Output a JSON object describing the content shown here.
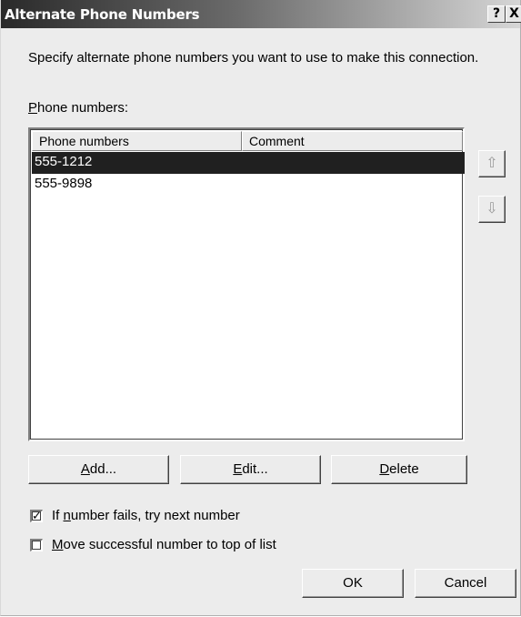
{
  "window": {
    "title": "Alternate Phone Numbers",
    "help_glyph": "?",
    "close_glyph": "X"
  },
  "description": "Specify alternate phone numbers you want to use to make this connection.",
  "list": {
    "label_first": "P",
    "label_rest": "hone numbers:",
    "columns": [
      "Phone numbers",
      "Comment"
    ],
    "rows": [
      {
        "number": "555-1212",
        "comment": "",
        "selected": true
      },
      {
        "number": "555-9898",
        "comment": "",
        "selected": false
      }
    ]
  },
  "side_buttons": {
    "up_icon": "arrow-up-icon",
    "down_icon": "arrow-down-icon",
    "up_glyph": "⇧",
    "down_glyph": "⇩"
  },
  "buttons": {
    "add_first": "A",
    "add_rest": "dd...",
    "edit_first": "E",
    "edit_rest": "dit...",
    "delete_first": "D",
    "delete_rest": "elete",
    "ok": "OK",
    "cancel": "Cancel"
  },
  "options": {
    "try_next": {
      "pre": "If ",
      "underlined": "n",
      "post": "umber fails, try next number",
      "checked": true,
      "check_glyph": "✓"
    },
    "move_top": {
      "pre": "",
      "underlined": "M",
      "post": "ove successful number to top of list",
      "checked": false
    }
  }
}
